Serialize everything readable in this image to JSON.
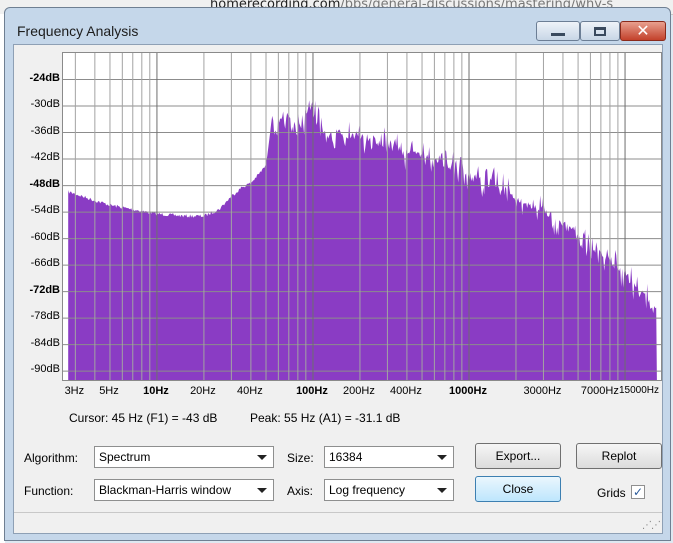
{
  "background": {
    "url_domain": "homerecording.com",
    "url_path": "/bbs/general-discussions/mastering/why-s"
  },
  "window": {
    "title": "Frequency Analysis",
    "controls": {
      "minimize": "minimize",
      "maximize": "maximize",
      "close": "close"
    }
  },
  "chart_data": {
    "type": "area",
    "color": "#8a3cc4",
    "grid": true,
    "x_scale": "log",
    "xlim": [
      2.5,
      17000
    ],
    "ylim": [
      -92,
      -18
    ],
    "yticks": [
      {
        "label": "-24dB",
        "value": -24,
        "bold": true
      },
      {
        "label": "-30dB",
        "value": -30,
        "bold": false
      },
      {
        "label": "-36dB",
        "value": -36,
        "bold": false
      },
      {
        "label": "-42dB",
        "value": -42,
        "bold": false
      },
      {
        "label": "-48dB",
        "value": -48,
        "bold": true
      },
      {
        "label": "-54dB",
        "value": -54,
        "bold": false
      },
      {
        "label": "-60dB",
        "value": -60,
        "bold": false
      },
      {
        "label": "-66dB",
        "value": -66,
        "bold": false
      },
      {
        "label": "-72dB",
        "value": -72,
        "bold": true
      },
      {
        "label": "-78dB",
        "value": -78,
        "bold": false
      },
      {
        "label": "-84dB",
        "value": -84,
        "bold": false
      },
      {
        "label": "-90dB",
        "value": -90,
        "bold": false
      }
    ],
    "xticks": [
      {
        "label": "3Hz",
        "value": 3,
        "bold": false
      },
      {
        "label": "5Hz",
        "value": 5,
        "bold": false
      },
      {
        "label": "10Hz",
        "value": 10,
        "bold": true
      },
      {
        "label": "20Hz",
        "value": 20,
        "bold": false
      },
      {
        "label": "40Hz",
        "value": 40,
        "bold": false
      },
      {
        "label": "100Hz",
        "value": 100,
        "bold": true
      },
      {
        "label": "200Hz",
        "value": 200,
        "bold": false
      },
      {
        "label": "400Hz",
        "value": 400,
        "bold": false
      },
      {
        "label": "1000Hz",
        "value": 1000,
        "bold": true
      },
      {
        "label": "3000Hz",
        "value": 3000,
        "bold": false
      },
      {
        "label": "7000Hz",
        "value": 7000,
        "bold": false
      },
      {
        "label": "15000Hz",
        "value": 15000,
        "bold": false
      }
    ],
    "envelope": [
      [
        2.7,
        -49
      ],
      [
        3,
        -49.5
      ],
      [
        4,
        -51
      ],
      [
        5,
        -52
      ],
      [
        7,
        -53
      ],
      [
        10,
        -54
      ],
      [
        15,
        -54.5
      ],
      [
        20,
        -54.5
      ],
      [
        25,
        -53
      ],
      [
        30,
        -50
      ],
      [
        35,
        -48
      ],
      [
        40,
        -47
      ],
      [
        45,
        -45
      ],
      [
        50,
        -43
      ],
      [
        55,
        -31
      ],
      [
        60,
        -30
      ],
      [
        65,
        -29
      ],
      [
        70,
        -27
      ],
      [
        80,
        -29
      ],
      [
        90,
        -27
      ],
      [
        100,
        -24
      ],
      [
        110,
        -29
      ],
      [
        130,
        -31
      ],
      [
        150,
        -30
      ],
      [
        200,
        -31
      ],
      [
        300,
        -33
      ],
      [
        400,
        -35
      ],
      [
        600,
        -36
      ],
      [
        800,
        -38
      ],
      [
        1000,
        -40
      ],
      [
        1500,
        -42
      ],
      [
        2000,
        -45
      ],
      [
        3000,
        -48
      ],
      [
        4000,
        -51
      ],
      [
        5000,
        -54
      ],
      [
        6000,
        -56
      ],
      [
        7000,
        -58
      ],
      [
        8000,
        -59
      ],
      [
        10000,
        -62
      ],
      [
        12000,
        -66
      ],
      [
        14000,
        -68
      ],
      [
        15000,
        -70
      ],
      [
        16000,
        -71
      ]
    ]
  },
  "cursor_readout": "Cursor: 45 Hz (F1) = -43 dB",
  "peak_readout": "Peak: 55 Hz (A1) = -31.1 dB",
  "controls": {
    "algorithm_label": "Algorithm:",
    "algorithm_value": "Spectrum",
    "size_label": "Size:",
    "size_value": "16384",
    "function_label": "Function:",
    "function_value": "Blackman-Harris window",
    "axis_label": "Axis:",
    "axis_value": "Log frequency",
    "export_label": "Export...",
    "replot_label": "Replot",
    "close_label": "Close",
    "grids_label": "Grids",
    "grids_checked": true
  }
}
